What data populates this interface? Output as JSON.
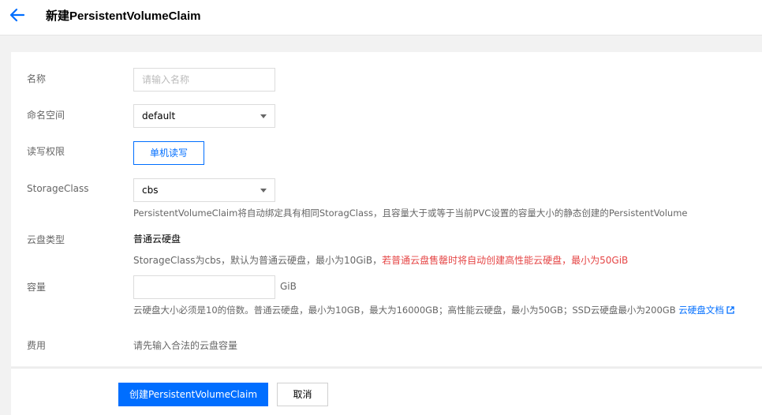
{
  "header": {
    "title": "新建PersistentVolumeClaim"
  },
  "form": {
    "name": {
      "label": "名称",
      "placeholder": "请输入名称",
      "value": ""
    },
    "namespace": {
      "label": "命名空间",
      "value": "default"
    },
    "access": {
      "label": "读写权限",
      "option": "单机读写"
    },
    "storage_class": {
      "label": "StorageClass",
      "value": "cbs",
      "hint": "PersistentVolumeClaim将自动绑定具有相同StoragClass，且容量大于或等于当前PVC设置的容量大小的静态创建的PersistentVolume"
    },
    "disk_type": {
      "label": "云盘类型",
      "value": "普通云硬盘",
      "hint": "StorageClass为cbs，默认为普通云硬盘，最小为10GiB，",
      "warning": "若普通云盘售罄时将自动创建高性能云硬盘，最小为50GiB"
    },
    "capacity": {
      "label": "容量",
      "value": "",
      "unit": "GiB",
      "hint": "云硬盘大小必须是10的倍数。普通云硬盘，最小为10GB，最大为16000GB；高性能云硬盘，最小为50GB；SSD云硬盘最小为200GB ",
      "doc_link": "云硬盘文档"
    },
    "fee": {
      "label": "费用",
      "value": "请先输入合法的云盘容量"
    }
  },
  "footer": {
    "create_label": "创建PersistentVolumeClaim",
    "cancel_label": "取消"
  },
  "icons": {
    "back": "arrow-left-icon",
    "dropdown": "chevron-down-icon",
    "external": "external-link-icon"
  },
  "colors": {
    "primary": "#006eff",
    "warning": "#e54545",
    "background": "#f2f2f2"
  }
}
